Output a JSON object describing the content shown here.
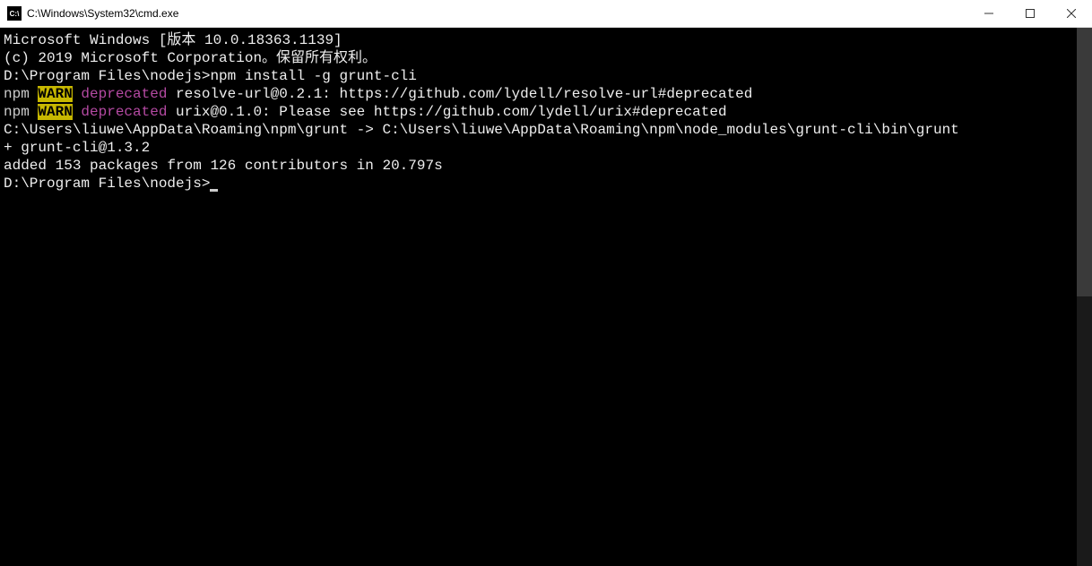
{
  "window": {
    "icon_label": "C:\\",
    "title": "C:\\Windows\\System32\\cmd.exe"
  },
  "terminal": {
    "line1": "Microsoft Windows [版本 10.0.18363.1139]",
    "line2": "(c) 2019 Microsoft Corporation。保留所有权利。",
    "blank": "",
    "prompt1_path": "D:\\Program Files\\nodejs>",
    "prompt1_cmd": "npm install -g grunt-cli",
    "npm_pref": "npm ",
    "warn_badge": "WARN",
    "deprecated_word": " deprecated",
    "warn1_msg": " resolve-url@0.2.1: https://github.com/lydell/resolve-url#deprecated",
    "warn2_msg": " urix@0.1.0: Please see https://github.com/lydell/urix#deprecated",
    "linkline": "C:\\Users\\liuwe\\AppData\\Roaming\\npm\\grunt -> C:\\Users\\liuwe\\AppData\\Roaming\\npm\\node_modules\\grunt-cli\\bin\\grunt",
    "plusline": "+ grunt-cli@1.3.2",
    "addedline": "added 153 packages from 126 contributors in 20.797s",
    "prompt2_path": "D:\\Program Files\\nodejs>"
  }
}
